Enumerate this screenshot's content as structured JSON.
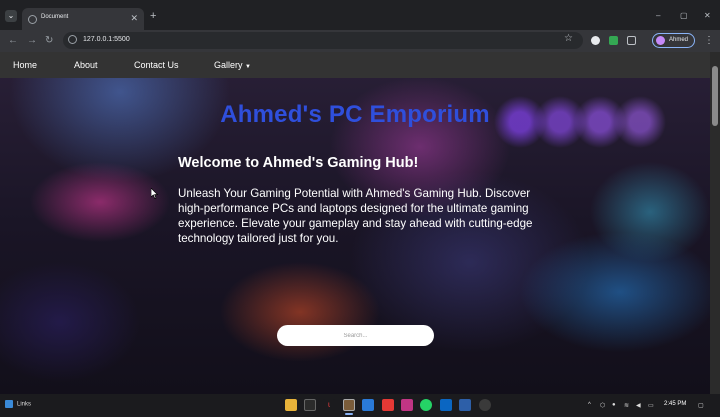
{
  "browser": {
    "tab_title": "Document",
    "url": "127.0.0.1:5500",
    "profile_name": "Ahmed",
    "icons": [
      "tab-list-icon",
      "new-tab-icon",
      "back-icon",
      "forward-icon",
      "reload-icon",
      "site-info-icon",
      "bookmark-star-icon",
      "extensions-icon",
      "menu-icon"
    ]
  },
  "nav": {
    "items": [
      {
        "label": "Home"
      },
      {
        "label": "About"
      },
      {
        "label": "Contact Us"
      },
      {
        "label": "Gallery"
      }
    ]
  },
  "hero": {
    "brand": "Ahmed's PC Emporium",
    "heading": "Welcome to Ahmed's Gaming Hub!",
    "paragraph": "Unleash Your Gaming Potential with Ahmed's Gaming Hub. Discover high-performance PCs and laptops designed for the ultimate gaming experience. Elevate your gameplay and stay ahead with cutting-edge technology tailored just for you.",
    "search_placeholder": "Search..."
  },
  "taskbar": {
    "weather_label": "Links",
    "time": "2:45 PM"
  },
  "colors": {
    "brand_text": "#2f4fdc",
    "navbar_bg": "#333333",
    "chrome_bg": "#202124"
  }
}
